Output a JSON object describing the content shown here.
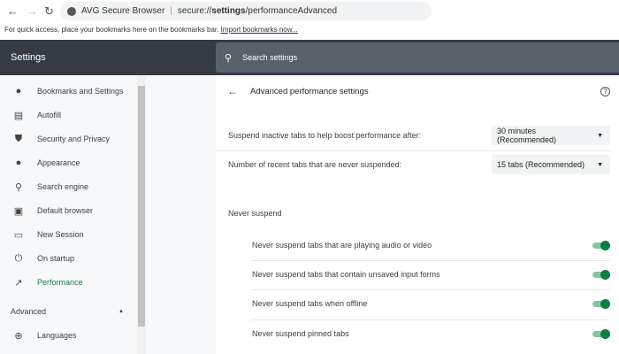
{
  "browser": {
    "name": "AVG Secure Browser",
    "url_prefix": "secure://",
    "url_bold": "settings",
    "url_rest": "/performanceAdvanced"
  },
  "bookmarks_bar": {
    "text": "For quick access, place your bookmarks here on the bookmarks bar.",
    "link": "Import bookmarks now..."
  },
  "header": {
    "title": "Settings",
    "search_placeholder": "Search settings"
  },
  "sidebar": {
    "items": [
      {
        "label": "Bookmarks and Settings",
        "icon": "person-icon"
      },
      {
        "label": "Autofill",
        "icon": "clipboard-icon"
      },
      {
        "label": "Security and Privacy",
        "icon": "shield-icon"
      },
      {
        "label": "Appearance",
        "icon": "palette-icon"
      },
      {
        "label": "Search engine",
        "icon": "search-icon"
      },
      {
        "label": "Default browser",
        "icon": "browser-icon"
      },
      {
        "label": "New Session",
        "icon": "window-icon"
      },
      {
        "label": "On startup",
        "icon": "power-icon"
      },
      {
        "label": "Performance",
        "icon": "trending-icon"
      }
    ],
    "advanced": "Advanced",
    "languages": "Languages"
  },
  "main": {
    "title": "Advanced performance settings",
    "suspend_label": "Suspend inactive tabs to help boost performance after:",
    "suspend_value": "30 minutes (Recommended)",
    "recent_label": "Number of recent tabs that are never suspended:",
    "recent_value": "15 tabs (Recommended)",
    "never_heading": "Never suspend",
    "toggles": [
      {
        "label": "Never suspend tabs that are playing audio or video",
        "on": true
      },
      {
        "label": "Never suspend tabs that contain unsaved input forms",
        "on": true
      },
      {
        "label": "Never suspend tabs when offline",
        "on": true
      },
      {
        "label": "Never suspend pinned tabs",
        "on": true
      }
    ]
  },
  "colors": {
    "accent": "#0b8043",
    "header": "#353a43"
  }
}
